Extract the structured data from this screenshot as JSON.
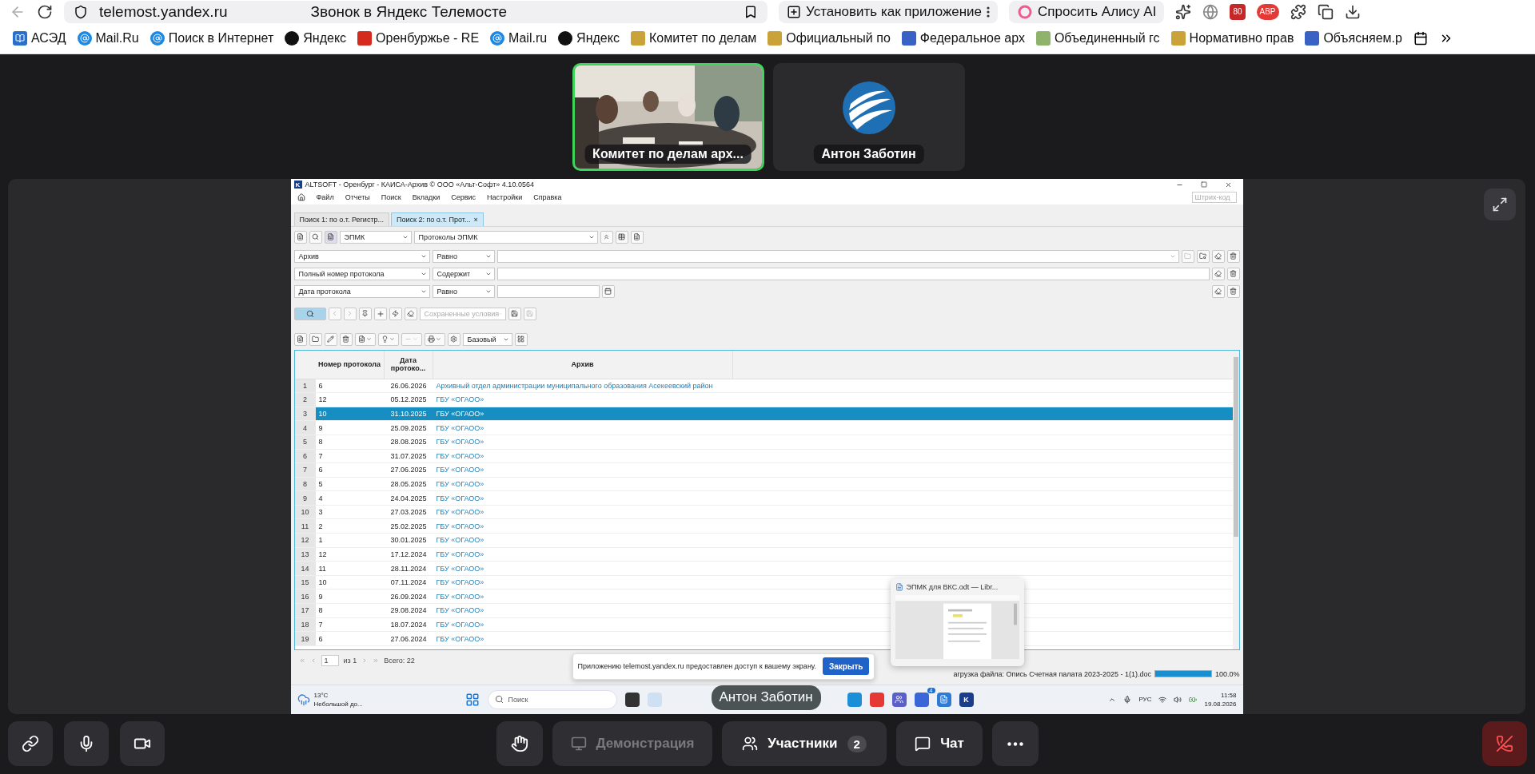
{
  "browser": {
    "address": "telemost.yandex.ru",
    "page_title": "Звонок в Яндекс Телемосте",
    "install_label": "Установить как приложение",
    "alice_label": "Спросить Алису AI",
    "ext_badge": "80",
    "abp": "ABP"
  },
  "bookmarks": [
    {
      "label": "АСЭД",
      "kind": "book"
    },
    {
      "label": "Mail.Ru",
      "kind": "mail"
    },
    {
      "label": "Поиск в Интернет",
      "kind": "mail"
    },
    {
      "label": "Яндекс",
      "kind": "star"
    },
    {
      "label": "Оренбуржье - RE",
      "kind": "flag"
    },
    {
      "label": "Mail.ru",
      "kind": "mail"
    },
    {
      "label": "Яндекс",
      "kind": "star"
    },
    {
      "label": "Комитет по делам",
      "kind": "crest"
    },
    {
      "label": "Официальный по",
      "kind": "crest"
    },
    {
      "label": "Федеральное арх",
      "kind": "doc"
    },
    {
      "label": "Объединенный гс",
      "kind": "small"
    },
    {
      "label": "Нормативно прав",
      "kind": "crest"
    },
    {
      "label": "Объясняем.р",
      "kind": "doc"
    }
  ],
  "participants": [
    {
      "name": "Комитет по делам арх...",
      "kind": "video",
      "speaking": true
    },
    {
      "name": "Антон Заботин",
      "kind": "avatar",
      "speaking": false
    }
  ],
  "app": {
    "logo": "K",
    "title": "ALTSOFT - Оренбург - КАИСА-Архив © ООО «Альт-Софт» 4.10.0564",
    "menu": [
      "Файл",
      "Отчеты",
      "Поиск",
      "Вкладки",
      "Сервис",
      "Настройки",
      "Справка"
    ],
    "barcode_placeholder": "Штрих-код",
    "tabs": [
      {
        "label": "Поиск 1: по о.т. Регистр...",
        "selected": false
      },
      {
        "label": "Поиск 2: по о.т. Прот...",
        "selected": true,
        "close": "×"
      }
    ],
    "source": "ЭПМК",
    "object_type": "Протоколы ЭПМК",
    "filters": [
      {
        "field": "Архив",
        "op": "Равно",
        "kind": "lookup"
      },
      {
        "field": "Полный номер протокола",
        "op": "Содержит",
        "kind": "text"
      },
      {
        "field": "Дата протокола",
        "op": "Равно",
        "kind": "date"
      }
    ],
    "saved_placeholder": "Сохраненные условия",
    "view": "Базовый",
    "columns": [
      "Номер протокола",
      "Дата протоко...",
      "Архив"
    ],
    "rows": [
      {
        "n": "1",
        "num": "6",
        "date": "26.06.2026",
        "archive": "Архивный отдел администрации муниципального образования Асекеевский район",
        "selected": false
      },
      {
        "n": "2",
        "num": "12",
        "date": "05.12.2025",
        "archive": "ГБУ «ОГАОО»",
        "selected": false
      },
      {
        "n": "3",
        "num": "10",
        "date": "31.10.2025",
        "archive": "ГБУ «ОГАОО»",
        "selected": true
      },
      {
        "n": "4",
        "num": "9",
        "date": "25.09.2025",
        "archive": "ГБУ «ОГАОО»",
        "selected": false
      },
      {
        "n": "5",
        "num": "8",
        "date": "28.08.2025",
        "archive": "ГБУ «ОГАОО»",
        "selected": false
      },
      {
        "n": "6",
        "num": "7",
        "date": "31.07.2025",
        "archive": "ГБУ «ОГАОО»",
        "selected": false
      },
      {
        "n": "7",
        "num": "6",
        "date": "27.06.2025",
        "archive": "ГБУ «ОГАОО»",
        "selected": false
      },
      {
        "n": "8",
        "num": "5",
        "date": "28.05.2025",
        "archive": "ГБУ «ОГАОО»",
        "selected": false
      },
      {
        "n": "9",
        "num": "4",
        "date": "24.04.2025",
        "archive": "ГБУ «ОГАОО»",
        "selected": false
      },
      {
        "n": "10",
        "num": "3",
        "date": "27.03.2025",
        "archive": "ГБУ «ОГАОО»",
        "selected": false
      },
      {
        "n": "11",
        "num": "2",
        "date": "25.02.2025",
        "archive": "ГБУ «ОГАОО»",
        "selected": false
      },
      {
        "n": "12",
        "num": "1",
        "date": "30.01.2025",
        "archive": "ГБУ «ОГАОО»",
        "selected": false
      },
      {
        "n": "13",
        "num": "12",
        "date": "17.12.2024",
        "archive": "ГБУ «ОГАОО»",
        "selected": false
      },
      {
        "n": "14",
        "num": "11",
        "date": "28.11.2024",
        "archive": "ГБУ «ОГАОО»",
        "selected": false
      },
      {
        "n": "15",
        "num": "10",
        "date": "07.11.2024",
        "archive": "ГБУ «ОГАОО»",
        "selected": false
      },
      {
        "n": "16",
        "num": "9",
        "date": "26.09.2024",
        "archive": "ГБУ «ОГАОО»",
        "selected": false
      },
      {
        "n": "17",
        "num": "8",
        "date": "29.08.2024",
        "archive": "ГБУ «ОГАОО»",
        "selected": false
      },
      {
        "n": "18",
        "num": "7",
        "date": "18.07.2024",
        "archive": "ГБУ «ОГАОО»",
        "selected": false
      },
      {
        "n": "19",
        "num": "6",
        "date": "27.06.2024",
        "archive": "ГБУ «ОГАОО»",
        "selected": false
      }
    ],
    "page": "1",
    "page_of": "из 1",
    "total": "Всего: 22",
    "download": {
      "text": "агрузка файла: Опись  Счетная палата 2023-2025 - 1(1).doc",
      "level": 1,
      "percent": "100.0%"
    }
  },
  "share_notice": {
    "text": "Приложению telemost.yandex.ru предоставлен доступ к вашему экрану.",
    "button": "Закрыть"
  },
  "preview": {
    "title": "ЭПМК для ВКС.odt — Libr..."
  },
  "taskbar": {
    "temp": "13°C",
    "weather": "Небольшой до...",
    "search_placeholder": "Поиск",
    "tooltip": "Антон Заботин",
    "badge": "4",
    "app_letter": "K",
    "lang": "РУС",
    "time": "11:58",
    "date": "19.08.2026"
  },
  "controls": {
    "demo": {
      "label": "Демонстрация",
      "disabled": true
    },
    "participants": {
      "label": "Участники",
      "count": "2"
    },
    "chat": {
      "label": "Чат"
    }
  }
}
